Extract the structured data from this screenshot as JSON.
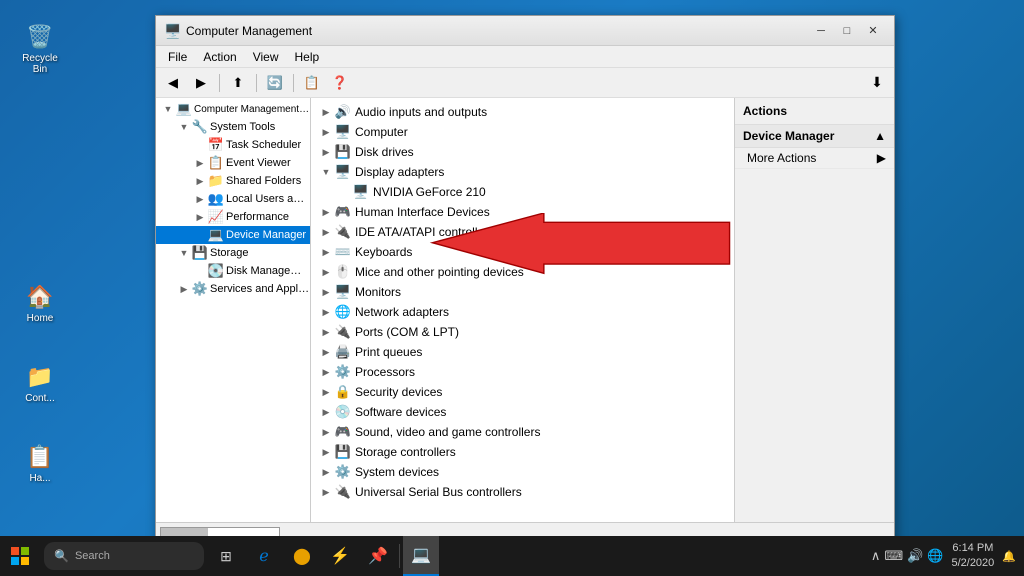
{
  "desktop": {
    "items": [
      {
        "label": "Recycle Bin",
        "icon": "🗑️"
      },
      {
        "label": "Home",
        "icon": "🏠"
      },
      {
        "label": "Cont...",
        "icon": "📁"
      },
      {
        "label": "Ha...",
        "icon": "📋"
      }
    ]
  },
  "taskbar": {
    "search_placeholder": "Search",
    "time": "6:14 PM",
    "date": "5/2/2020"
  },
  "window": {
    "title": "Computer Management",
    "menu": [
      "File",
      "Action",
      "View",
      "Help"
    ],
    "left_tree": [
      {
        "label": "Computer Management (Local",
        "indent": 1,
        "expanded": true,
        "icon": "💻"
      },
      {
        "label": "System Tools",
        "indent": 2,
        "expanded": true,
        "icon": "🔧"
      },
      {
        "label": "Task Scheduler",
        "indent": 3,
        "icon": "📅"
      },
      {
        "label": "Event Viewer",
        "indent": 3,
        "icon": "📋"
      },
      {
        "label": "Shared Folders",
        "indent": 3,
        "icon": "📁"
      },
      {
        "label": "Local Users and Groups",
        "indent": 3,
        "icon": "👥"
      },
      {
        "label": "Performance",
        "indent": 3,
        "icon": "📈"
      },
      {
        "label": "Device Manager",
        "indent": 3,
        "icon": "💻",
        "selected": true
      },
      {
        "label": "Storage",
        "indent": 2,
        "expanded": true,
        "icon": "💾"
      },
      {
        "label": "Disk Management",
        "indent": 3,
        "icon": "💽"
      },
      {
        "label": "Services and Applications",
        "indent": 2,
        "icon": "⚙️"
      }
    ],
    "devices": [
      {
        "label": "Audio inputs and outputs",
        "icon": "🔊",
        "expand": true
      },
      {
        "label": "Computer",
        "icon": "🖥️",
        "expand": true
      },
      {
        "label": "Disk drives",
        "icon": "💾",
        "expand": true
      },
      {
        "label": "Display adapters",
        "icon": "🖥️",
        "expand": false,
        "expanded": true
      },
      {
        "label": "NVIDIA GeForce 210",
        "icon": "🖥️",
        "child": true
      },
      {
        "label": "Human Interface Devices",
        "icon": "🎮",
        "expand": true
      },
      {
        "label": "IDE ATA/ATAPI controllers",
        "icon": "🔌",
        "expand": true
      },
      {
        "label": "Keyboards",
        "icon": "⌨️",
        "expand": true
      },
      {
        "label": "Mice and other pointing devices",
        "icon": "🖱️",
        "expand": true
      },
      {
        "label": "Monitors",
        "icon": "🖥️",
        "expand": true
      },
      {
        "label": "Network adapters",
        "icon": "🌐",
        "expand": true
      },
      {
        "label": "Ports (COM & LPT)",
        "icon": "🔌",
        "expand": true
      },
      {
        "label": "Print queues",
        "icon": "🖨️",
        "expand": true
      },
      {
        "label": "Processors",
        "icon": "⚙️",
        "expand": true
      },
      {
        "label": "Security devices",
        "icon": "🔒",
        "expand": true
      },
      {
        "label": "Software devices",
        "icon": "💿",
        "expand": true
      },
      {
        "label": "Sound, video and game controllers",
        "icon": "🎮",
        "expand": true
      },
      {
        "label": "Storage controllers",
        "icon": "💾",
        "expand": true
      },
      {
        "label": "System devices",
        "icon": "⚙️",
        "expand": true
      },
      {
        "label": "Universal Serial Bus controllers",
        "icon": "🔌",
        "expand": true
      }
    ],
    "actions": {
      "header": "Actions",
      "section": "Device Manager",
      "items": [
        "More Actions"
      ]
    }
  }
}
